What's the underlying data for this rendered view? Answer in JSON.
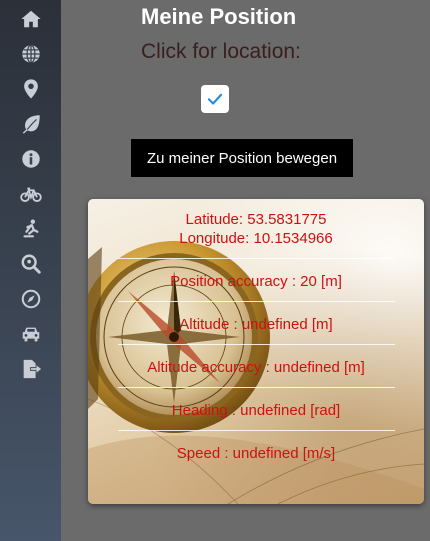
{
  "sidebar": {
    "items": [
      {
        "icon": "home-icon",
        "name": "sidebar-item-home"
      },
      {
        "icon": "globe-icon",
        "name": "sidebar-item-globe"
      },
      {
        "icon": "map-marker-icon",
        "name": "sidebar-item-location"
      },
      {
        "icon": "leaf-icon",
        "name": "sidebar-item-leaf"
      },
      {
        "icon": "info-icon",
        "name": "sidebar-item-info"
      },
      {
        "icon": "bicycle-icon",
        "name": "sidebar-item-bicycle"
      },
      {
        "icon": "skating-icon",
        "name": "sidebar-item-activity"
      },
      {
        "icon": "search-location-icon",
        "name": "sidebar-item-search"
      },
      {
        "icon": "compass-icon",
        "name": "sidebar-item-compass"
      },
      {
        "icon": "car-icon",
        "name": "sidebar-item-car"
      },
      {
        "icon": "file-export-icon",
        "name": "sidebar-item-export"
      }
    ],
    "icon_color": "#c9ced6"
  },
  "main": {
    "title": "Meine Position",
    "click_label": "Click for location:",
    "checkbox_checked": true,
    "move_button_label": "Zu meiner Position bewegen"
  },
  "card": {
    "latitude": "Latitude: 53.5831775",
    "longitude": "Longitude: 10.1534966",
    "position_accuracy": "Position accuracy : 20 [m]",
    "altitude": "Altitude : undefined [m]",
    "altitude_accuracy": "Altitude accuracy : undefined [m]",
    "heading": "Heading : undefined [rad]",
    "speed": "Speed : undefined [m/s]",
    "text_color": "#cc1111"
  }
}
